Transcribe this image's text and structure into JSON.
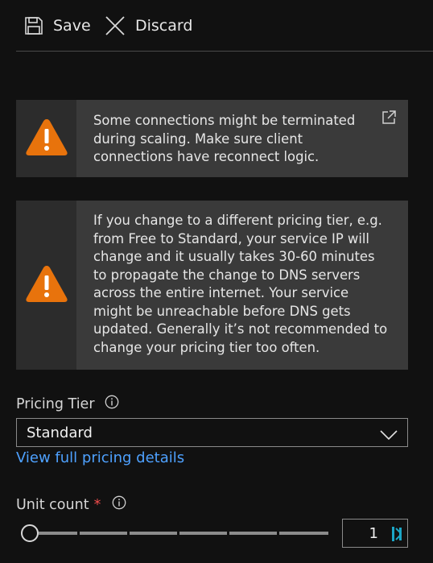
{
  "toolbar": {
    "save_label": "Save",
    "discard_label": "Discard"
  },
  "warnings": {
    "scaling": "Some connections might be terminated during scaling. Make sure client connections have reconnect logic.",
    "pricing_tier_change": "If you change to a different pricing tier, e.g. from Free to Standard, your service IP will change and it usually takes 30-60 minutes to propagate the change to DNS servers across the entire internet. Your service might be unreachable before DNS gets updated. Generally it’s not recommended to change your pricing tier too often."
  },
  "pricing_tier": {
    "label": "Pricing Tier",
    "selected": "Standard",
    "details_link": "View full pricing details"
  },
  "unit_count": {
    "label": "Unit count",
    "required_marker": "*",
    "value": "1",
    "slider_fraction": 0
  },
  "colors": {
    "background": "#111111",
    "warning_orange": "#e8730c",
    "link_blue": "#4ea1ff",
    "required_red": "#f14c4c"
  },
  "icons": {
    "save": "save-icon",
    "discard": "close-icon",
    "warning": "warning-icon",
    "external": "external-link-icon",
    "info": "info-icon",
    "dropdown": "chevron-down-icon",
    "spinner": "spin-buttons-icon"
  }
}
